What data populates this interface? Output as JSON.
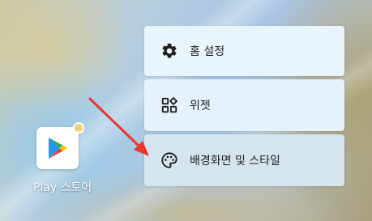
{
  "launcher": {
    "app": {
      "label": "Play 스토어",
      "icon": "play-store-icon",
      "badge_color": "#f2cf79"
    }
  },
  "context_menu": {
    "items": [
      {
        "label": "홈 설정",
        "icon": "gear-icon"
      },
      {
        "label": "위젯",
        "icon": "widgets-icon"
      },
      {
        "label": "배경화면 및 스타일",
        "icon": "palette-icon"
      }
    ]
  },
  "annotation": {
    "color": "#e8362c",
    "points_to": "배경화면 및 스타일"
  }
}
